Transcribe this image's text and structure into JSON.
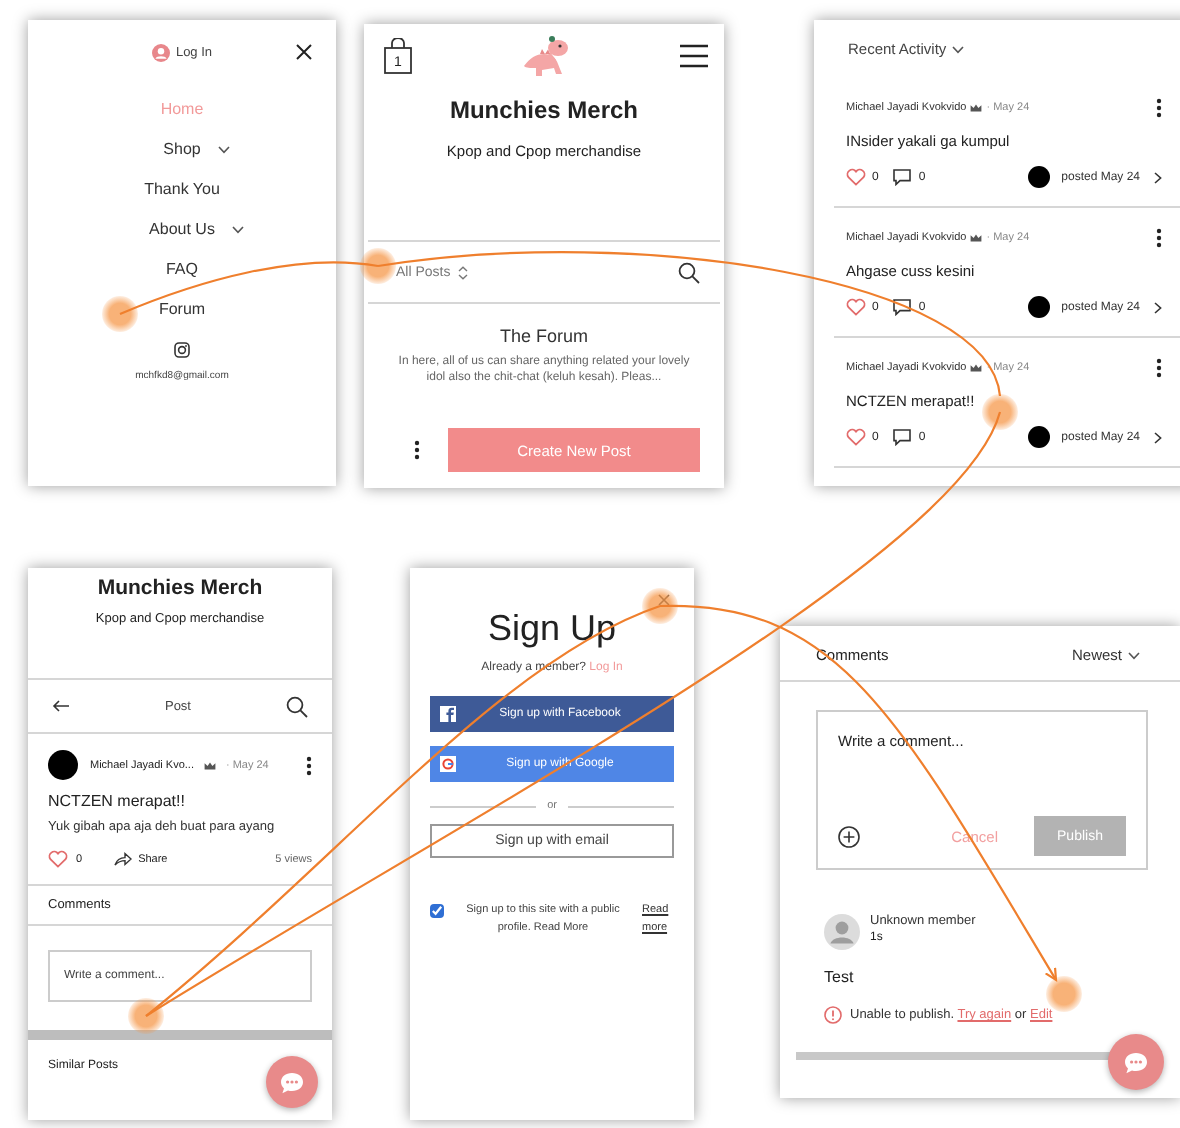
{
  "menu_screen": {
    "login": "Log In",
    "items": [
      {
        "label": "Home",
        "selected": true,
        "submenu": false
      },
      {
        "label": "Shop",
        "selected": false,
        "submenu": true
      },
      {
        "label": "Thank You",
        "selected": false,
        "submenu": false
      },
      {
        "label": "About Us",
        "selected": false,
        "submenu": true
      },
      {
        "label": "FAQ",
        "selected": false,
        "submenu": false
      },
      {
        "label": "Forum",
        "selected": false,
        "submenu": false
      }
    ],
    "email": "mchfkd8@gmail.com"
  },
  "forum_screen": {
    "cart_count": "1",
    "title": "Munchies Merch",
    "subtitle": "Kpop and Cpop merchandise",
    "filter": "All Posts",
    "heading": "The Forum",
    "description": "In here, all of us can share anything related your lovely idol also the chit-chat (keluh kesah). Pleas...",
    "button": "Create New Post"
  },
  "activity_screen": {
    "filter": "Recent Activity",
    "posts": [
      {
        "author": "Michael Jayadi Kvokvido",
        "date": "· May 24",
        "title": "INsider yakali ga kumpul",
        "likes": "0",
        "comments": "0",
        "posted": "posted May 24"
      },
      {
        "author": "Michael Jayadi Kvokvido",
        "date": "· May 24",
        "title": "Ahgase cuss kesini",
        "likes": "0",
        "comments": "0",
        "posted": "posted May 24"
      },
      {
        "author": "Michael Jayadi Kvokvido",
        "date": "· May 24",
        "title": "NCTZEN merapat!!",
        "likes": "0",
        "comments": "0",
        "posted": "posted May 24"
      }
    ]
  },
  "post_screen": {
    "title": "Munchies Merch",
    "subtitle": "Kpop and Cpop merchandise",
    "header": "Post",
    "author": "Michael Jayadi Kvo...",
    "date": "· May 24",
    "post_title": "NCTZEN merapat!!",
    "body": "Yuk gibah apa aja deh buat para ayang",
    "likes": "0",
    "share": "Share",
    "views": "5 views",
    "comments_label": "Comments",
    "placeholder": "Write a comment...",
    "similar": "Similar Posts"
  },
  "signup_screen": {
    "title": "Sign Up",
    "member_prompt": "Already a member?",
    "login_link": "Log In",
    "facebook": "Sign up with Facebook",
    "google": "Sign up with Google",
    "or": "or",
    "email": "Sign up with email",
    "consent": "Sign up to this site with a public profile. Read More",
    "consent_checked": true,
    "read_more": "Read more"
  },
  "comments_screen": {
    "heading": "Comments",
    "sort": "Newest",
    "placeholder": "Write a comment...",
    "cancel": "Cancel",
    "publish": "Publish",
    "publish_disabled": true,
    "author": "Unknown member",
    "time": "1s",
    "text": "Test",
    "error": "Unable to publish.",
    "retry": "Try again",
    "or": "or",
    "edit": "Edit"
  }
}
